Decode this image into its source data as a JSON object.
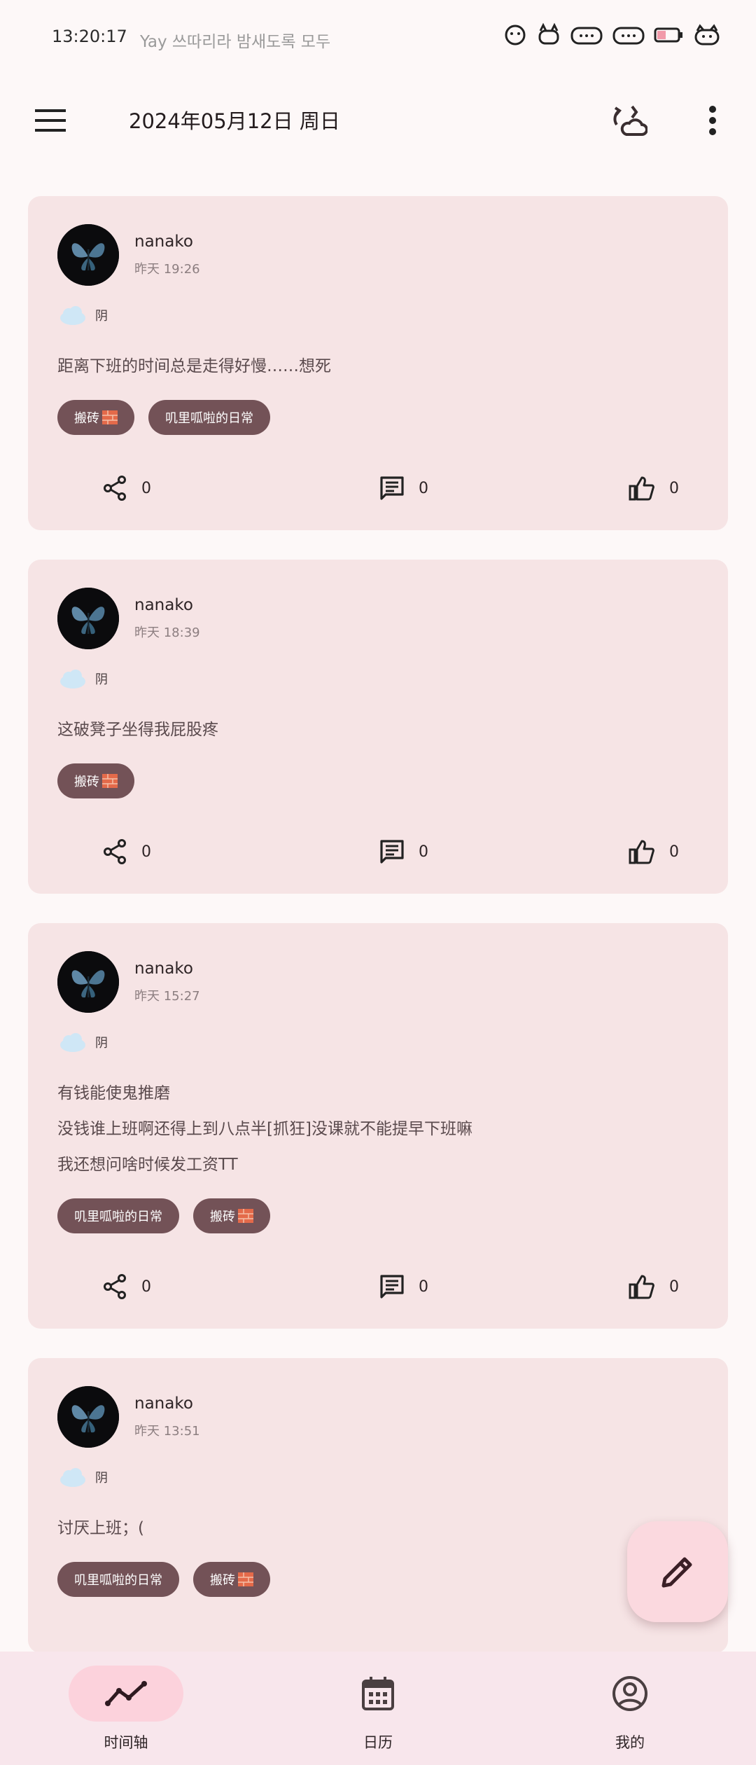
{
  "status_bar": {
    "time": "13:20:17",
    "notification": "Yay 쓰따리라 밤새도록 모두"
  },
  "app_bar": {
    "date": "2024年05月12日 周日",
    "menu_icon": "hamburger-menu-icon",
    "sync_icon": "cloud-sync-icon",
    "more_icon": "more-vert-icon"
  },
  "posts": [
    {
      "author": "nanako",
      "time": "昨天 19:26",
      "weather": "阴",
      "lines": [
        "距离下班的时间总是走得好慢……想死"
      ],
      "tags": [
        "搬砖",
        "叽里呱啦的日常"
      ],
      "share_count": "0",
      "comment_count": "0",
      "like_count": "0"
    },
    {
      "author": "nanako",
      "time": "昨天 18:39",
      "weather": "阴",
      "lines": [
        "这破凳子坐得我屁股疼"
      ],
      "tags": [
        "搬砖"
      ],
      "share_count": "0",
      "comment_count": "0",
      "like_count": "0"
    },
    {
      "author": "nanako",
      "time": "昨天 15:27",
      "weather": "阴",
      "lines": [
        "有钱能使鬼推磨",
        "没钱谁上班啊还得上到八点半[抓狂]没课就不能提早下班嘛",
        "我还想问啥时候发工资TT"
      ],
      "tags": [
        "叽里呱啦的日常",
        "搬砖"
      ],
      "share_count": "0",
      "comment_count": "0",
      "like_count": "0"
    },
    {
      "author": "nanako",
      "time": "昨天 13:51",
      "weather": "阴",
      "lines": [
        "讨厌上班；("
      ],
      "tags": [
        "叽里呱啦的日常",
        "搬砖"
      ]
    }
  ],
  "bottom_nav": [
    {
      "label": "时间轴",
      "icon": "timeline-icon",
      "active": true
    },
    {
      "label": "日历",
      "icon": "calendar-icon",
      "active": false
    },
    {
      "label": "我的",
      "icon": "profile-icon",
      "active": false
    }
  ],
  "colors": {
    "card_bg": "#f6e4e5",
    "tag_bg": "#735257",
    "fab_bg": "#fbd9df",
    "nav_bg": "#f8e6ec",
    "nav_active": "#fcd2dc"
  }
}
